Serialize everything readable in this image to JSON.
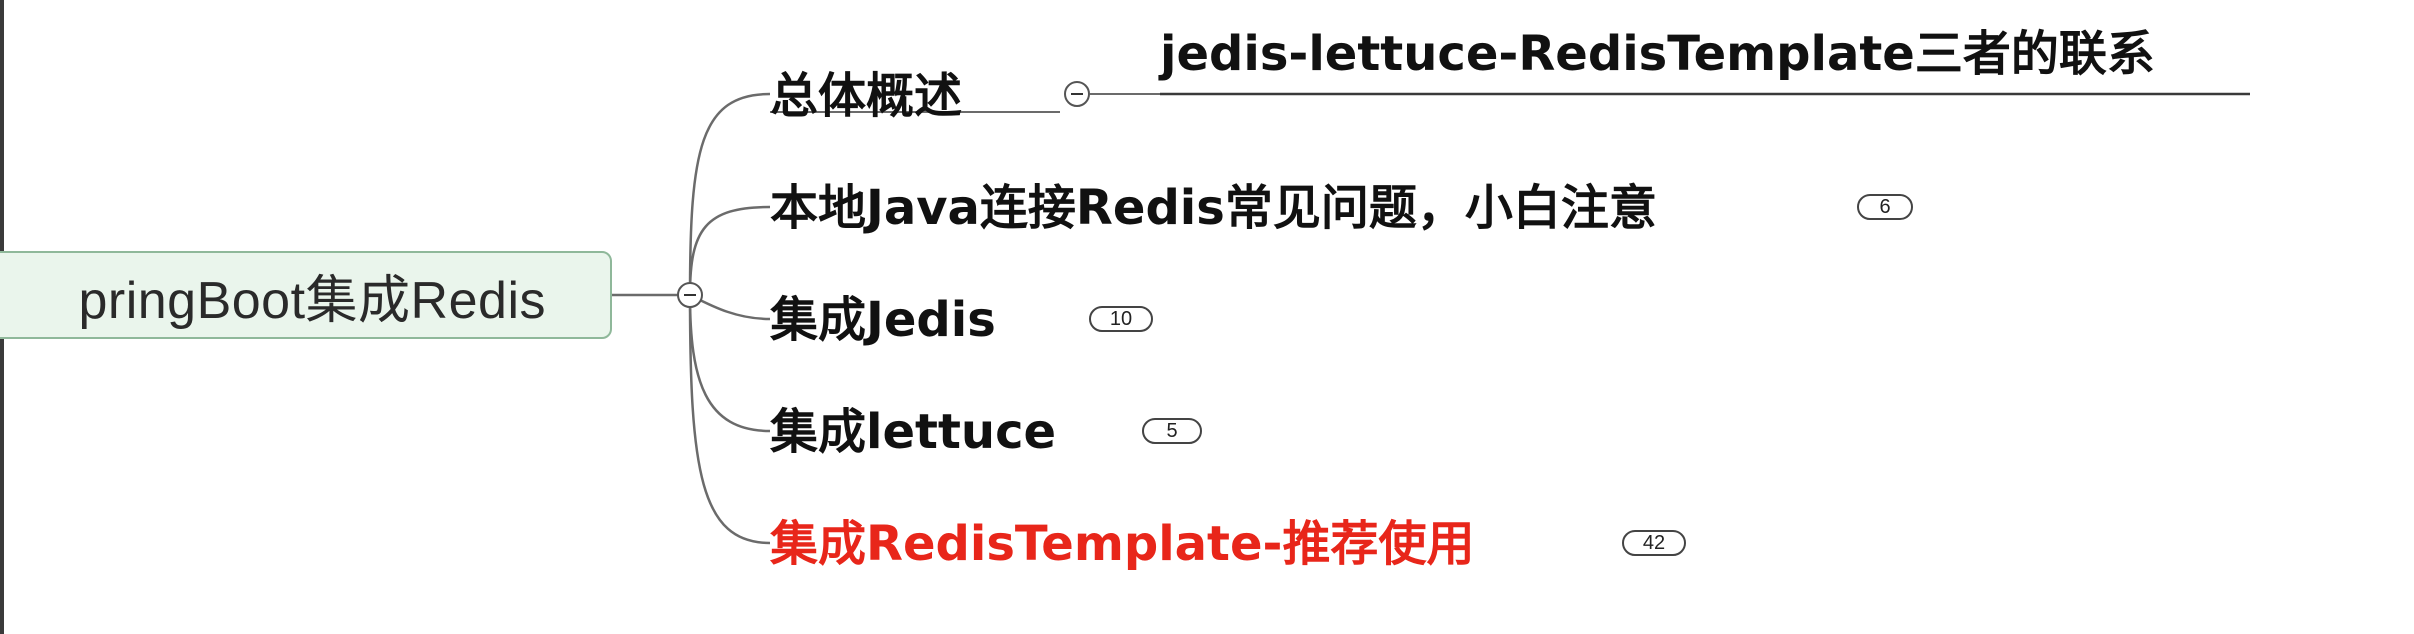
{
  "mindmap": {
    "root": {
      "label": "SpringBoot集成Redis",
      "visible_label": "pringBoot集成Redis"
    },
    "branches": [
      {
        "label": "总体概述",
        "highlighted": false,
        "expanded": true,
        "children": [
          {
            "label": "jedis-lettuce-RedisTemplate三者的联系"
          }
        ]
      },
      {
        "label": "本地Java连接Redis常见问题，小白注意",
        "highlighted": false,
        "expanded": false,
        "count": "6"
      },
      {
        "label": "集成Jedis",
        "highlighted": false,
        "expanded": false,
        "count": "10"
      },
      {
        "label": "集成lettuce",
        "highlighted": false,
        "expanded": false,
        "count": "5"
      },
      {
        "label": "集成RedisTemplate-推荐使用",
        "highlighted": true,
        "expanded": false,
        "count": "42"
      }
    ]
  },
  "colors": {
    "highlight": "#e8261a",
    "text": "#111111",
    "root_fill": "#eaf5ec",
    "root_border": "#8fb89a",
    "connector": "#6b6b6b"
  }
}
